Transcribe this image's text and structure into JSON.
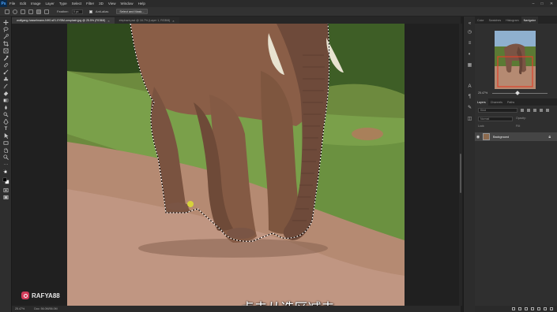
{
  "menubar": {
    "logo": "Ps",
    "items": [
      "File",
      "Edit",
      "Image",
      "Layer",
      "Type",
      "Select",
      "Filter",
      "3D",
      "View",
      "Window",
      "Help"
    ],
    "window_controls": [
      "–",
      "□",
      "✕"
    ]
  },
  "options_bar": {
    "feather_label": "Feather:",
    "feather_value": "0 px",
    "antialias_label": "Anti-alias",
    "select_mask_label": "Select and Mask..."
  },
  "tabs": [
    {
      "label": "wolfgang-hasselmann-NH0-sEl-XYBM-unsplash.jpg @ 25.5% (RGB/8)",
      "active": true
    },
    {
      "label": "elephant.psd @ 16.7% (Layer 1, RGB/8)",
      "active": false
    }
  ],
  "canvas": {
    "subtitle": "点击从选区减去",
    "watermark": "RAFYA88"
  },
  "statusbar": {
    "zoom": "25.47%",
    "doc_info": "Doc: 56.0M/56.0M"
  },
  "panels": {
    "top_tabs": [
      "Color",
      "Swatches",
      "Histogram",
      "Navigator"
    ],
    "active_top_tab": "Navigator",
    "nav_zoom": "25.47%",
    "layer_tabs": [
      "Layers",
      "Channels",
      "Paths"
    ],
    "search_placeholder": "Kind",
    "blend_mode": "Normal",
    "opacity_label": "Opacity:",
    "lock_label": "Lock:",
    "fill_label": "Fill:",
    "layer_name": "Background"
  }
}
